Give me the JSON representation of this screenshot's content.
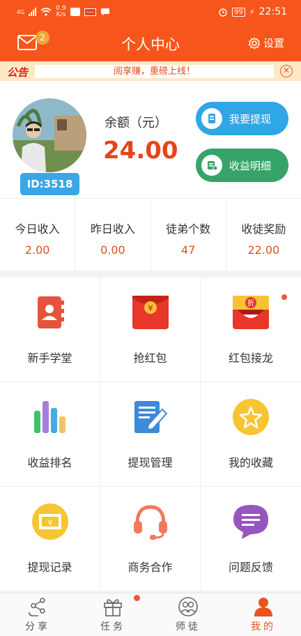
{
  "status_bar": {
    "network_type": "4G",
    "speed_value": "0.9",
    "speed_unit": "K/s",
    "battery": "99",
    "time": "22:51"
  },
  "header": {
    "title": "个人中心",
    "settings_label": "设置",
    "mail_badge": "2"
  },
  "notice": {
    "label": "公告",
    "text": "阅享赚，重磅上线！"
  },
  "profile": {
    "user_id": "ID:3518",
    "balance_label": "余额（元）",
    "balance_value": "24.00",
    "withdraw_button": "我要提现",
    "income_detail_button": "收益明细"
  },
  "stats": [
    {
      "label": "今日收入",
      "value": "2.00"
    },
    {
      "label": "昨日收入",
      "value": "0.00"
    },
    {
      "label": "徒弟个数",
      "value": "47"
    },
    {
      "label": "收徒奖励",
      "value": "22.00"
    }
  ],
  "menu": [
    {
      "label": "新手学堂",
      "icon": "contacts-book-icon"
    },
    {
      "label": "抢红包",
      "icon": "red-envelope-icon",
      "icon_text": "¥"
    },
    {
      "label": "红包接龙",
      "icon": "discount-envelope-icon",
      "icon_text": "折"
    },
    {
      "label": "收益排名",
      "icon": "bar-ranking-icon"
    },
    {
      "label": "提现管理",
      "icon": "document-edit-icon"
    },
    {
      "label": "我的收藏",
      "icon": "star-favorite-icon"
    },
    {
      "label": "提现记录",
      "icon": "bill-record-icon",
      "icon_text": "¥"
    },
    {
      "label": "商务合作",
      "icon": "headset-icon"
    },
    {
      "label": "问题反馈",
      "icon": "chat-bubble-icon"
    }
  ],
  "tabbar": [
    {
      "label": "分享",
      "icon": "share-icon"
    },
    {
      "label": "任务",
      "icon": "gift-icon"
    },
    {
      "label": "师徒",
      "icon": "people-icon"
    },
    {
      "label": "我的",
      "icon": "person-icon"
    }
  ],
  "colors": {
    "brand_orange": "#f6561b",
    "withdraw_blue": "#2fa6e5",
    "income_green": "#36a468",
    "value_red": "#e5451b"
  }
}
